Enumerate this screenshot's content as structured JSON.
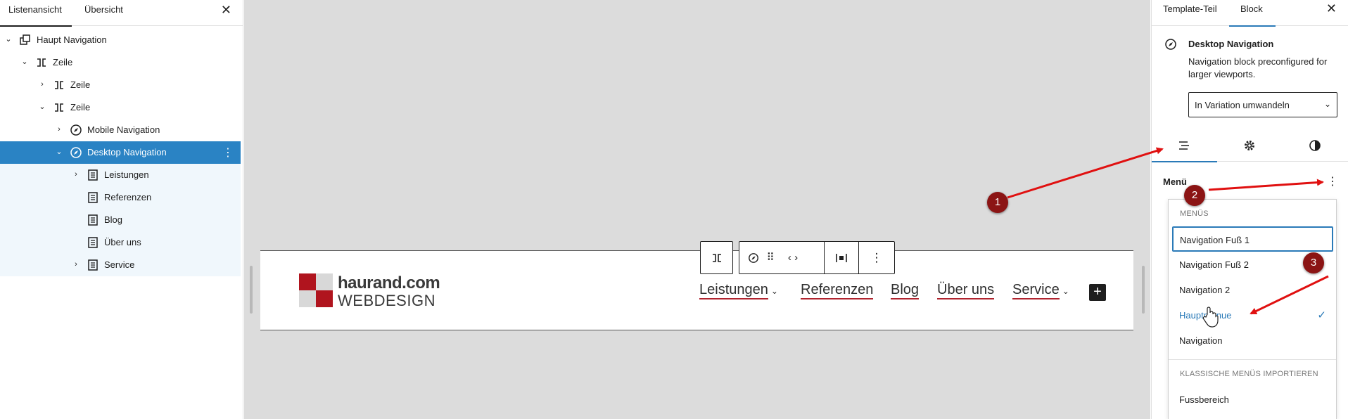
{
  "left_panel": {
    "tabs": [
      "Listenansicht",
      "Übersicht"
    ],
    "tree": [
      {
        "label": "Haupt Navigation"
      },
      {
        "label": "Zeile"
      },
      {
        "label": "Zeile"
      },
      {
        "label": "Zeile"
      },
      {
        "label": "Mobile Navigation"
      },
      {
        "label": "Desktop Navigation"
      },
      {
        "label": "Leistungen"
      },
      {
        "label": "Referenzen"
      },
      {
        "label": "Blog"
      },
      {
        "label": "Über uns"
      },
      {
        "label": "Service"
      }
    ]
  },
  "canvas": {
    "logo": {
      "line1": "haurand.com",
      "line2": "WEBDESIGN"
    },
    "nav_items": [
      "Leistungen",
      "Referenzen",
      "Blog",
      "Über uns",
      "Service"
    ],
    "plus_glyph": "+"
  },
  "right_panel": {
    "tabs": [
      "Template-Teil",
      "Block"
    ],
    "block_title": "Desktop Navigation",
    "block_description": "Navigation block preconfigured for larger viewports.",
    "variation_select": "In Variation umwandeln",
    "menu_label": "Menü",
    "dropdown": {
      "heading_menus": "MENÜS",
      "menus": [
        "Navigation Fuß 1",
        "Navigation Fuß 2",
        "Navigation 2",
        "Hauptmenue",
        "Navigation"
      ],
      "selected": "Hauptmenue",
      "heading_classic": "KLASSISCHE MENÜS IMPORTIEREN",
      "classic": [
        "Fussbereich"
      ]
    }
  },
  "annotations": [
    "1",
    "2",
    "3"
  ],
  "colors": {
    "accent": "#2a7ab8",
    "selection": "#2a83c4",
    "brand_red": "#b0141e",
    "badge": "#8b1414",
    "arrow": "#e01010"
  }
}
